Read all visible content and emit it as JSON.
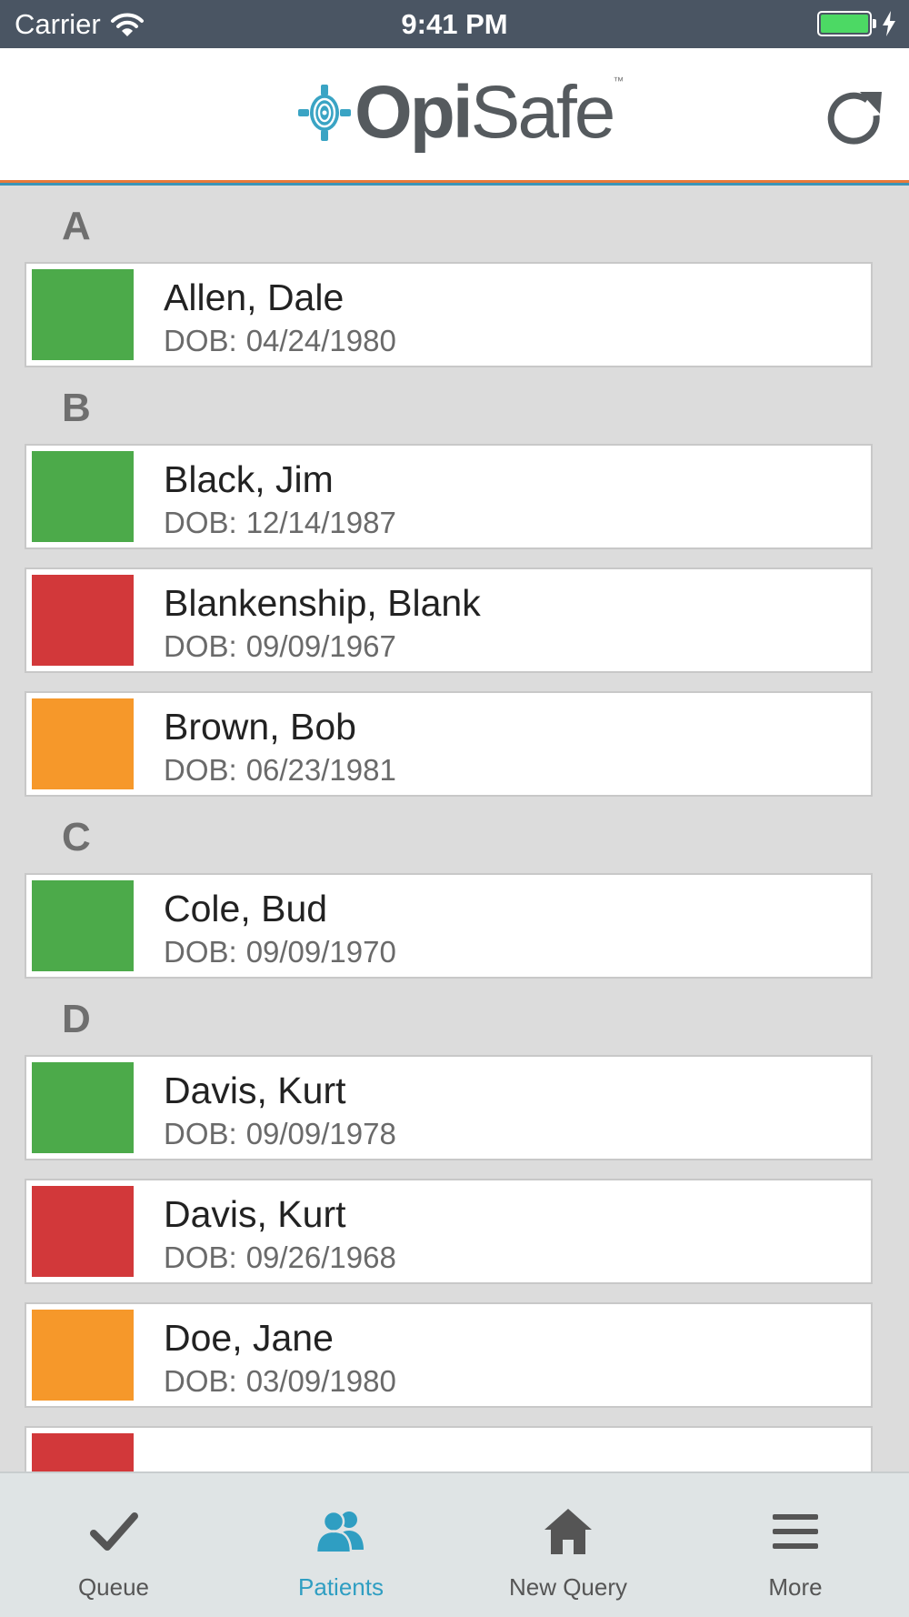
{
  "status_bar": {
    "carrier": "Carrier",
    "time": "9:41 PM",
    "battery_level": 1.0,
    "icons": [
      "wifi-icon",
      "battery-icon",
      "charging-bolt-icon"
    ]
  },
  "header": {
    "logo_opi": "Opi",
    "logo_safe": "Safe",
    "logo_tm": "™",
    "refresh_icon": "refresh-icon"
  },
  "colors": {
    "green": "#4caa4a",
    "red": "#d2383a",
    "orange": "#f6982a",
    "accent": "#2f9ec2",
    "status_bar_bg": "#4a5563",
    "header_line_orange": "#e8793a",
    "header_line_blue": "#3b95b8"
  },
  "sections": [
    {
      "letter": "A",
      "patients": [
        {
          "name": "Allen, Dale",
          "dob_label": "DOB:",
          "dob": "04/24/1980",
          "status": "green"
        }
      ]
    },
    {
      "letter": "B",
      "patients": [
        {
          "name": "Black, Jim",
          "dob_label": "DOB:",
          "dob": "12/14/1987",
          "status": "green"
        },
        {
          "name": "Blankenship, Blank",
          "dob_label": "DOB:",
          "dob": "09/09/1967",
          "status": "red"
        },
        {
          "name": "Brown, Bob",
          "dob_label": "DOB:",
          "dob": "06/23/1981",
          "status": "orange"
        }
      ]
    },
    {
      "letter": "C",
      "patients": [
        {
          "name": "Cole, Bud",
          "dob_label": "DOB:",
          "dob": "09/09/1970",
          "status": "green"
        }
      ]
    },
    {
      "letter": "D",
      "patients": [
        {
          "name": "Davis, Kurt",
          "dob_label": "DOB:",
          "dob": "09/09/1978",
          "status": "green"
        },
        {
          "name": "Davis, Kurt",
          "dob_label": "DOB:",
          "dob": "09/26/1968",
          "status": "red"
        },
        {
          "name": "Doe, Jane",
          "dob_label": "DOB:",
          "dob": "03/09/1980",
          "status": "orange"
        }
      ]
    }
  ],
  "partial_row": {
    "status": "red"
  },
  "tabs": [
    {
      "label": "Queue",
      "icon": "checkmark-icon",
      "active": false
    },
    {
      "label": "Patients",
      "icon": "patients-icon",
      "active": true
    },
    {
      "label": "New Query",
      "icon": "home-icon",
      "active": false
    },
    {
      "label": "More",
      "icon": "menu-icon",
      "active": false
    }
  ]
}
